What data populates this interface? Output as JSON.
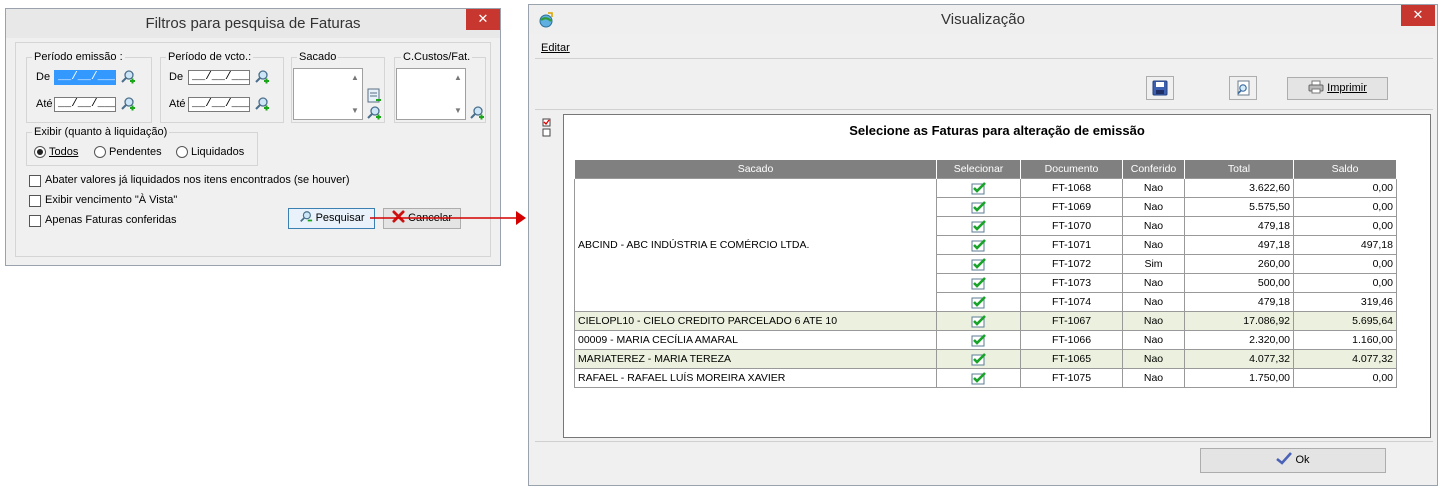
{
  "filter_dialog": {
    "title": "Filtros para pesquisa de Faturas",
    "close": "✕",
    "periodo_emissao": {
      "label": "Período emissão :",
      "de_label": "De",
      "ate_label": "Até",
      "de_value": "__/__/____",
      "ate_value": "__/__/____"
    },
    "periodo_vcto": {
      "label": "Período de vcto.:",
      "de_label": "De",
      "ate_label": "Até",
      "de_value": "__/__/____",
      "ate_value": "__/__/____"
    },
    "sacado_label": "Sacado",
    "ccustos_label": "C.Custos/Fat.",
    "exibir": {
      "label": "Exibir (quanto à liquidação)",
      "options": [
        "Todos",
        "Pendentes",
        "Liquidados"
      ],
      "selected": "Todos"
    },
    "checkboxes": [
      "Abater valores já liquidados nos itens encontrados (se houver)",
      "Exibir vencimento \"À Vista\"",
      "Apenas Faturas conferidas"
    ],
    "search_button": "Pesquisar",
    "cancel_button": "Cancelar"
  },
  "preview": {
    "title": "Visualização",
    "close": "✕",
    "menu": [
      "Editar"
    ],
    "print_button": "Imprimir",
    "heading": "Selecione as Faturas para alteração de emissão",
    "columns": [
      "Sacado",
      "Selecionar",
      "Documento",
      "Conferido",
      "Total",
      "Saldo"
    ],
    "group_sacado": "ABCIND - ABC INDÚSTRIA E COMÉRCIO LTDA.",
    "rows": [
      {
        "documento": "FT-1068",
        "conferido": "Nao",
        "total": "3.622,60",
        "saldo": "0,00"
      },
      {
        "documento": "FT-1069",
        "conferido": "Nao",
        "total": "5.575,50",
        "saldo": "0,00"
      },
      {
        "documento": "FT-1070",
        "conferido": "Nao",
        "total": "479,18",
        "saldo": "0,00"
      },
      {
        "documento": "FT-1071",
        "conferido": "Nao",
        "total": "497,18",
        "saldo": "497,18"
      },
      {
        "documento": "FT-1072",
        "conferido": "Sim",
        "total": "260,00",
        "saldo": "0,00"
      },
      {
        "documento": "FT-1073",
        "conferido": "Nao",
        "total": "500,00",
        "saldo": "0,00"
      },
      {
        "documento": "FT-1074",
        "conferido": "Nao",
        "total": "479,18",
        "saldo": "319,46"
      }
    ],
    "other_rows": [
      {
        "sacado": "CIELOPL10 - CIELO CREDITO PARCELADO 6 ATE 10",
        "documento": "FT-1067",
        "conferido": "Nao",
        "total": "17.086,92",
        "saldo": "5.695,64",
        "highlight": true
      },
      {
        "sacado": "00009 - MARIA CECÍLIA AMARAL",
        "documento": "FT-1066",
        "conferido": "Nao",
        "total": "2.320,00",
        "saldo": "1.160,00",
        "highlight": false
      },
      {
        "sacado": "MARIATEREZ - MARIA TEREZA",
        "documento": "FT-1065",
        "conferido": "Nao",
        "total": "4.077,32",
        "saldo": "4.077,32",
        "highlight": true
      },
      {
        "sacado": "RAFAEL - RAFAEL LUÍS MOREIRA XAVIER",
        "documento": "FT-1075",
        "conferido": "Nao",
        "total": "1.750,00",
        "saldo": "0,00",
        "highlight": false
      }
    ],
    "ok_button": "Ok"
  },
  "colors": {
    "close_red": "#c7372f",
    "arrow_red": "#d40000",
    "header_gray": "#808080",
    "highlight_row": "#ebf1de"
  }
}
